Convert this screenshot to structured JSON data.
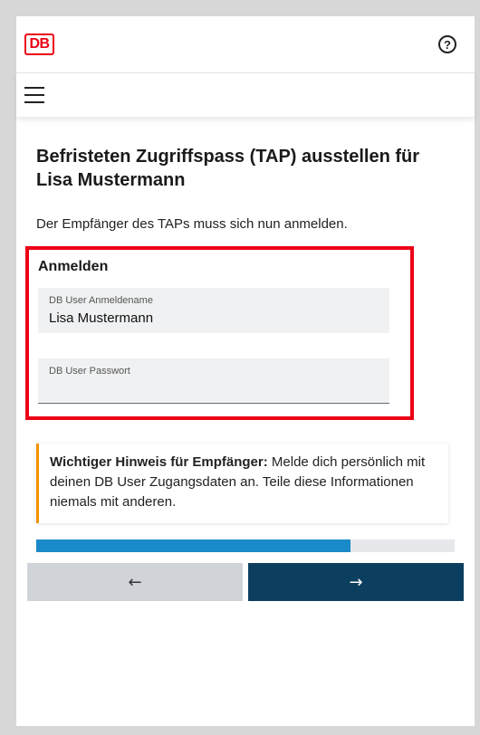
{
  "header": {
    "logo_text": "DB",
    "help_icon": "?"
  },
  "menu": {
    "icon": "hamburger-menu-icon"
  },
  "page": {
    "title": "Befristeten Zugriffspass (TAP) ausstellen für Lisa Mustermann",
    "intro": "Der Empfänger des TAPs muss sich nun anmelden."
  },
  "login": {
    "heading": "Anmelden",
    "username_label": "DB User Anmeldename",
    "username_value": "Lisa Mustermann",
    "password_label": "DB User Passwort",
    "password_value": ""
  },
  "notice": {
    "bold": "Wichtiger Hinweis für Empfänger:",
    "text": " Melde dich persönlich mit deinen DB User Zugangsdaten an. Teile diese Informationen niemals mit anderen.",
    "accent_color": "#f39200"
  },
  "progress": {
    "percent": 75,
    "color": "#1a8ac9"
  },
  "nav": {
    "back_label": "←",
    "next_label": "→"
  },
  "colors": {
    "brand_red": "#ec0016",
    "primary": "#0c3f5f"
  }
}
